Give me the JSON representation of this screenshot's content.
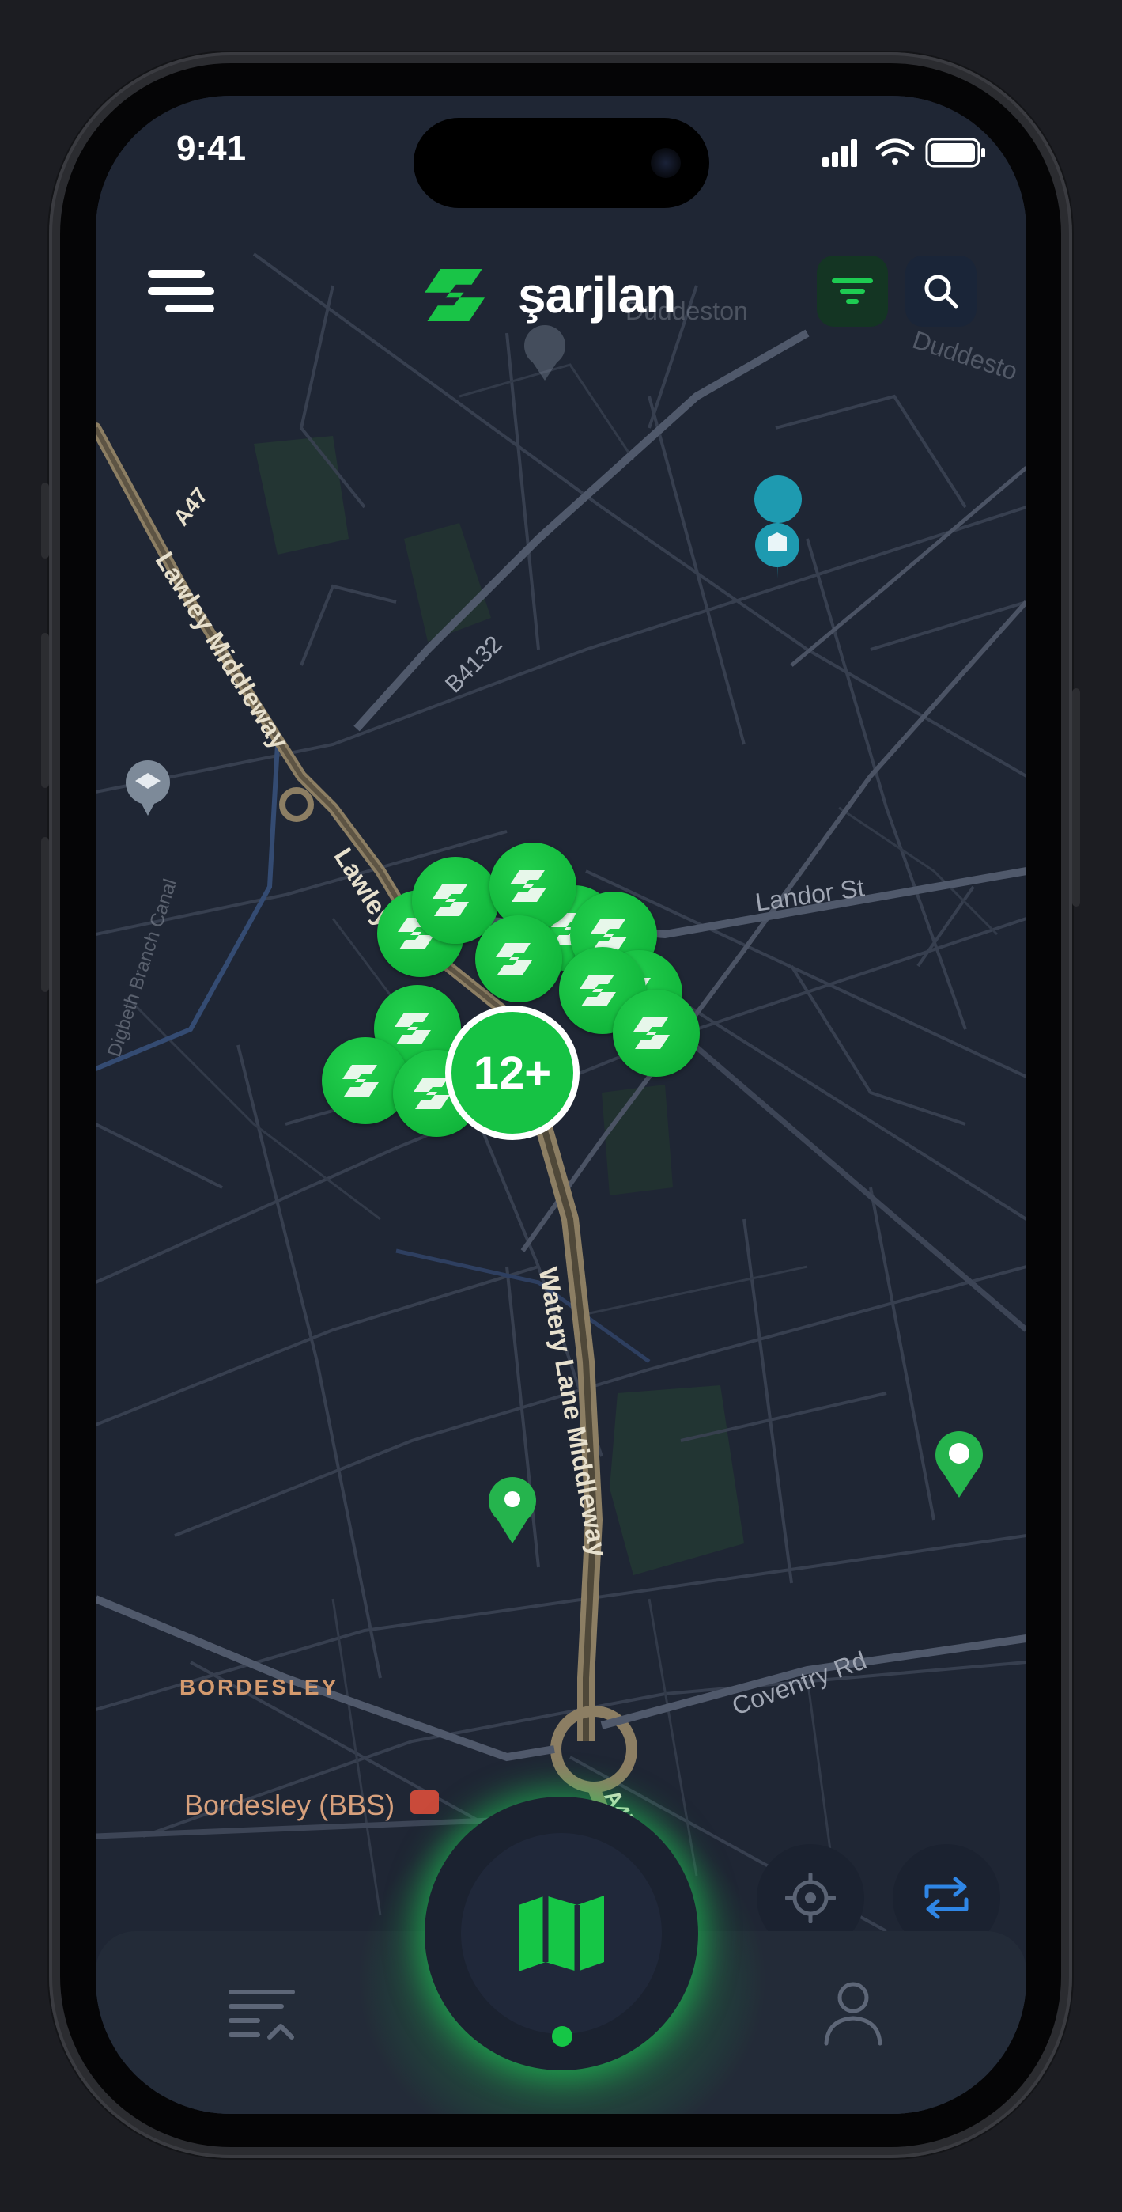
{
  "status_bar": {
    "time": "9:41"
  },
  "header": {
    "app_name": "şarjlan",
    "menu_icon": "menu-icon",
    "filter_icon": "filter-icon",
    "search_icon": "search-icon"
  },
  "map": {
    "labels": {
      "a47": "A47",
      "lawley_middleway_1": "Lawley Middleway",
      "lawley_middleway_2": "Lawley Mid",
      "b4132": "B4132",
      "landor_st": "Landor St",
      "watery_lane": "Watery Lane Middleway",
      "coventry_rd": "Coventry Rd",
      "bordesley": "BORDESLEY",
      "bordesley_station": "Bordesley (BBS)",
      "duddeston": "Duddeston",
      "duddeston_2": "Duddesto",
      "canal": "Digbeth Branch Canal",
      "a45": "A45"
    },
    "cluster_count": "12+",
    "accent_color": "#16c244"
  },
  "controls": {
    "locate_icon": "crosshair-icon",
    "route_icon": "route-swap-icon"
  },
  "tabbar": {
    "list_icon": "list-icon",
    "map_icon": "map-icon",
    "profile_icon": "profile-icon"
  }
}
